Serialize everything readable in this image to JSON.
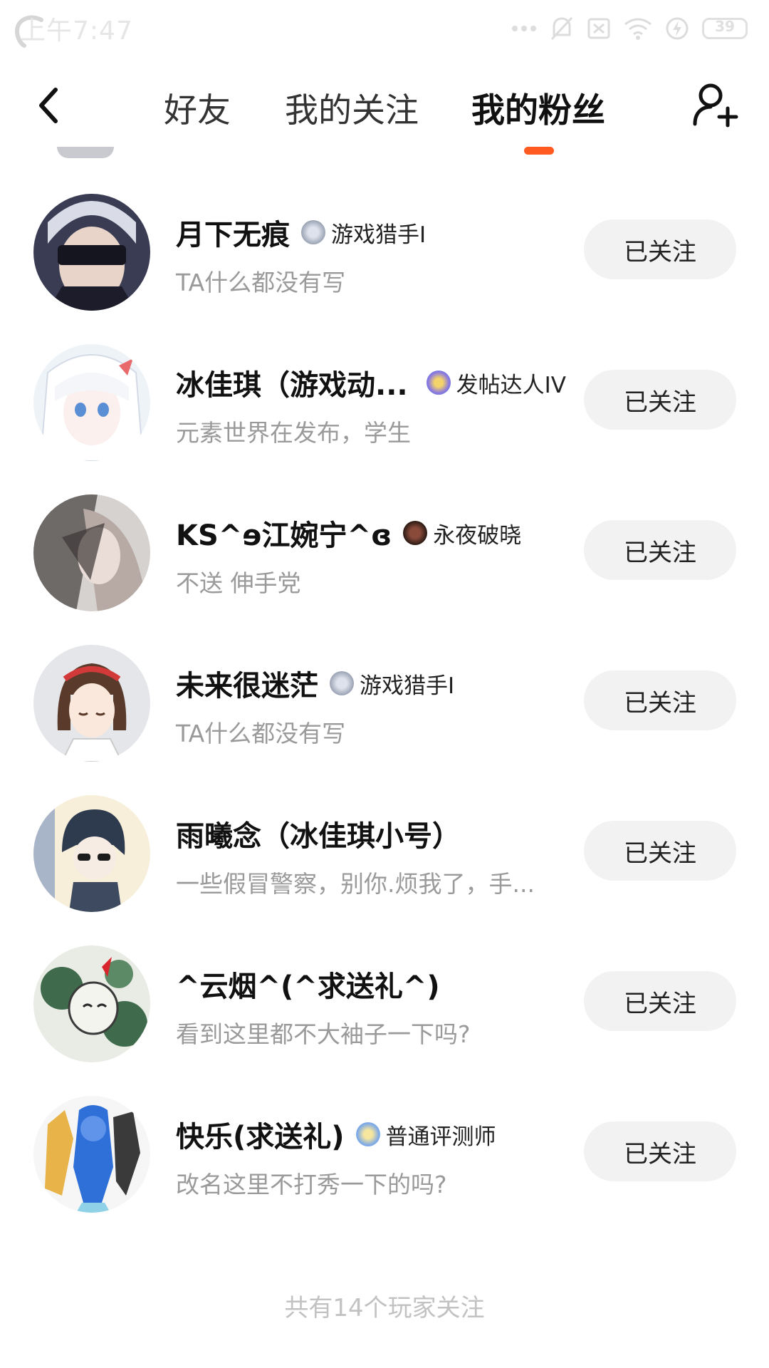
{
  "status_bar": {
    "time": "上午7:47",
    "battery": "39"
  },
  "nav": {
    "tabs": [
      {
        "label": "好友"
      },
      {
        "label": "我的关注"
      },
      {
        "label": "我的粉丝"
      }
    ],
    "active_tab": 2,
    "accent": "#ff5a1f"
  },
  "fans": [
    {
      "name": "月下无痕",
      "badge": "游戏猎手I",
      "badge_icon": "hunter-badge-icon",
      "bio": "TA什么都没有写",
      "button": "已关注"
    },
    {
      "name": "冰佳琪（游戏动...",
      "badge": "发帖达人IV",
      "badge_icon": "poster-badge-icon",
      "bio": "元素世界在发布，学生",
      "button": "已关注"
    },
    {
      "name": "KS^ɘ江婉宁^ɞ",
      "badge": "永夜破晓",
      "badge_icon": "night-badge-icon",
      "bio": "不送 伸手党",
      "button": "已关注"
    },
    {
      "name": "未来很迷茫",
      "badge": "游戏猎手I",
      "badge_icon": "hunter-badge-icon",
      "bio": "TA什么都没有写",
      "button": "已关注"
    },
    {
      "name": "雨曦念（冰佳琪小号）",
      "badge": "",
      "badge_icon": "",
      "bio": "一些假冒警察，别你.烦我了，手...",
      "button": "已关注"
    },
    {
      "name": "^云烟^(^求送礼^)",
      "badge": "",
      "badge_icon": "",
      "bio": "看到这里都不大袖子一下吗?",
      "button": "已关注"
    },
    {
      "name": "快乐(求送礼)",
      "badge": "普通评测师",
      "badge_icon": "reviewer-badge-icon",
      "bio": "改名这里不打秀一下的吗?",
      "button": "已关注"
    }
  ],
  "footer": {
    "text": "共有14个玩家关注"
  }
}
